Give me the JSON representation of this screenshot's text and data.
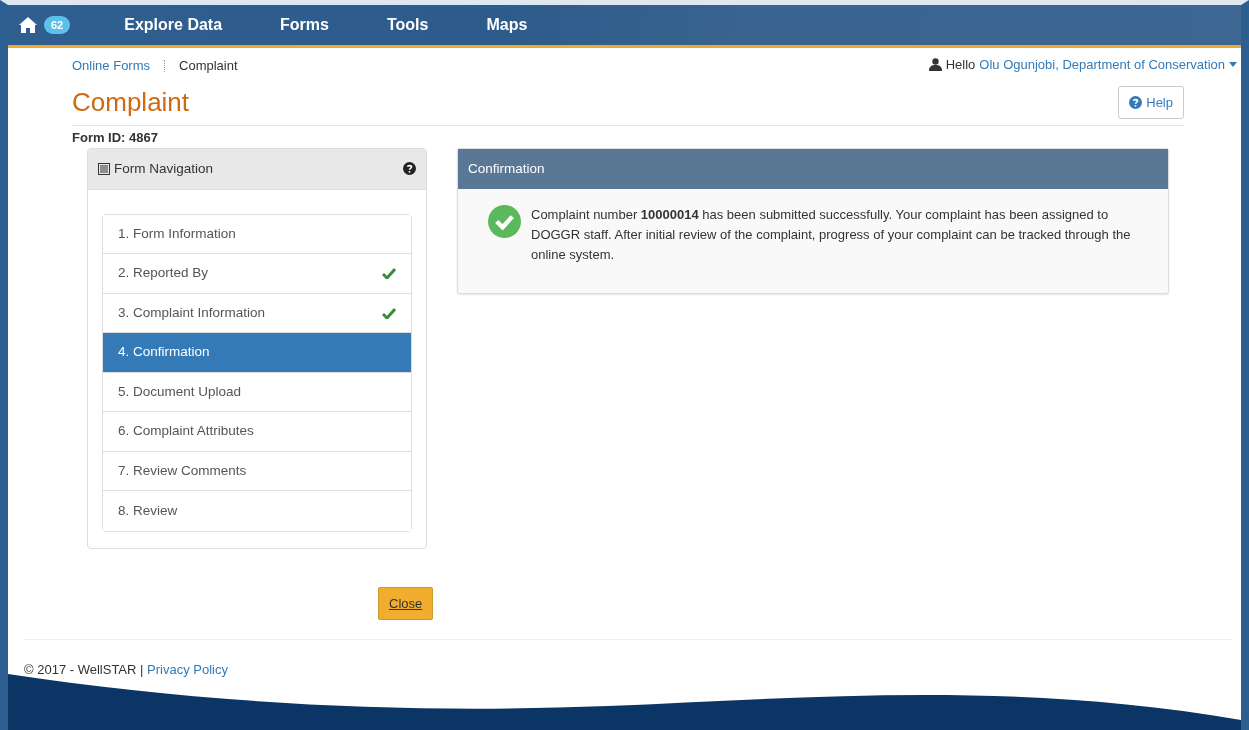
{
  "navbar": {
    "badge": "62",
    "items": [
      {
        "label": "Explore Data"
      },
      {
        "label": "Forms"
      },
      {
        "label": "Tools"
      },
      {
        "label": "Maps"
      }
    ]
  },
  "breadcrumb": [
    {
      "label": "Online Forms",
      "kind": "link"
    },
    {
      "label": "Complaint",
      "kind": "current"
    }
  ],
  "user": {
    "greeting": "Hello",
    "name": "Olu Ogunjobi, Department of Conservation"
  },
  "page": {
    "title": "Complaint",
    "help_button": "Help",
    "form_id": "Form ID: 4867"
  },
  "navigation": {
    "title": "Form Navigation",
    "steps": [
      {
        "label": "1. Form Information",
        "completed": false,
        "selected": false
      },
      {
        "label": "2. Reported By",
        "completed": true,
        "selected": false
      },
      {
        "label": "3. Complaint Information",
        "completed": true,
        "selected": false
      },
      {
        "label": "4. Confirmation",
        "completed": false,
        "selected": true
      },
      {
        "label": "5. Document Upload",
        "completed": false,
        "selected": false
      },
      {
        "label": "6. Complaint Attributes",
        "completed": false,
        "selected": false
      },
      {
        "label": "7. Review Comments",
        "completed": false,
        "selected": false
      },
      {
        "label": "8. Review",
        "completed": false,
        "selected": false
      }
    ]
  },
  "confirmation": {
    "title": "Confirmation",
    "message": "Complaint number **10000014** has been submitted successfully. Your complaint has been assigned to DOGGR staff. After initial review of the complaint, progress of your complaint can be tracked through the online system."
  },
  "close_button": "Close",
  "footer": {
    "text": "© 2017 - WellSTAR |",
    "link": "Privacy Policy"
  }
}
